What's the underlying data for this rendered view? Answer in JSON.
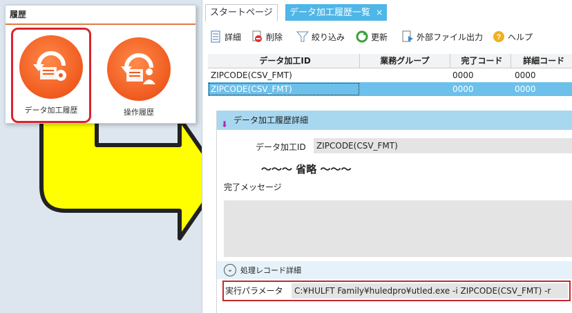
{
  "left_panel": {
    "title": "履歴",
    "tiles": [
      {
        "label": "データ加工履歴",
        "icon": "data-process-history-icon"
      },
      {
        "label": "操作履歴",
        "icon": "operation-history-icon"
      }
    ]
  },
  "tabs": [
    {
      "label": "スタートページ"
    },
    {
      "label": "データ加工履歴一覧",
      "close": "×"
    }
  ],
  "toolbar": {
    "detail": "詳細",
    "delete": "削除",
    "filter": "絞り込み",
    "refresh": "更新",
    "export": "外部ファイル出力",
    "help": "ヘルプ"
  },
  "grid": {
    "columns": [
      "データ加工ID",
      "業務グループ",
      "完了コード",
      "詳細コード"
    ],
    "rows": [
      [
        "ZIPCODE(CSV_FMT)",
        "",
        "0000",
        "0000"
      ],
      [
        "ZIPCODE(CSV_FMT)",
        "",
        "0000",
        "0000"
      ]
    ]
  },
  "detail": {
    "title": "データ加工履歴詳細",
    "id_label": "データ加工ID",
    "id_value": "ZIPCODE(CSV_FMT)",
    "omitted": "～～～ 省略 ～～～",
    "message_label": "完了メッセージ",
    "records_title": "処理レコード詳細",
    "param_label": "実行パラメータ",
    "param_value": "C:¥HULFT Family¥huledpro¥utled.exe -i ZIPCODE(CSV_FMT) -r"
  },
  "colors": {
    "accent": "#4fb6e8",
    "highlight": "#d9242c",
    "arrow": "#ffff00",
    "orange": "#f05a1e"
  }
}
